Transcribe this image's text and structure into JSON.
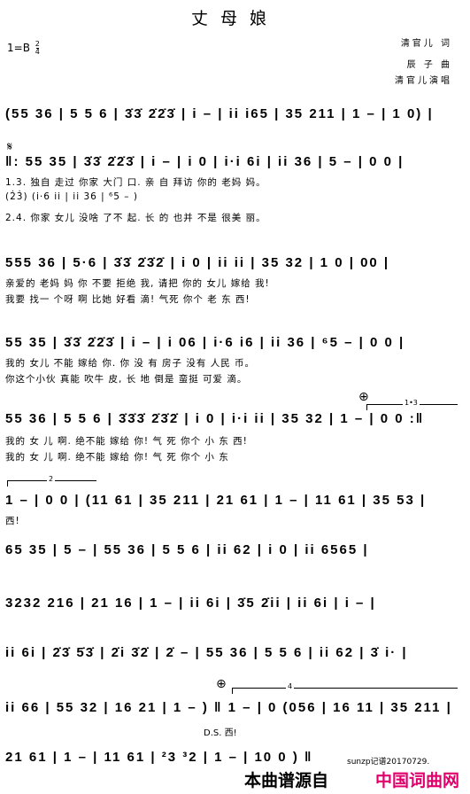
{
  "title": "丈母娘",
  "key_signature": "1=B",
  "time_signature": {
    "top": "2",
    "bottom": "4"
  },
  "credits": [
    "清官儿  词",
    "辰  子  曲",
    "清官儿演唱"
  ],
  "colors": {
    "text": "#000000",
    "brand": "#e0006c"
  },
  "score": [
    {
      "id": "line-1",
      "notes": "(55 36 | 5 5 6 | 3̇3̇ 2̇2̇3̇ | i – | ii i65 | 35 211 | 1 – | 1 0) |"
    },
    {
      "id": "line-2",
      "prefix": "𝄋",
      "notes": "‖: 55 35 | 3̇3̇ 2̇2̇3̇ | i – | i 0 | i·i 6i | ii 36 | 5 – | 0 0 |",
      "lyrics": [
        "1.3. 独自 走过  你家 大门    口.              亲  自 拜访  你的 老妈   妈。",
        "                   (2̇3̇)                   (i·6 ii | ii 36 | ⁶5 – )",
        "2.4. 你家 女儿  没啥 了不     起.              长  的 也并  不是 很美   丽。"
      ]
    },
    {
      "id": "line-3",
      "notes": "555 36 | 5·6 | 3̇3̇ 2̇3̇2̇ | i 0 | ii ii | 35 32 | 1 0 | 00 |",
      "lyrics": [
        "亲爱的 老妈  妈  你   不要 拒绝     我,      请把 你的  女儿 嫁给    我!",
        "我要   找一  个呀 啊   比她 好看     滴!      气死 你个  老   东      西!"
      ]
    },
    {
      "id": "line-4",
      "notes": "55 35 | 3̇3̇ 2̇2̇3̇ | i – | i 06 | i·6 i6 | ii 36 | ⁶5 – | 0 0 |",
      "lyrics": [
        "我的  女儿  不能 嫁给   你.          你  没  有 房子  没有 人民    币。",
        "你这个小伙  真能 吹牛   皮,              长  地 倒是  蛮挺 可爱    滴。"
      ]
    },
    {
      "id": "line-5",
      "notes": "55 36 | 5 5 6 | 3̇3̇3̇ 2̇3̇2̇ | i 0 | i·i ii | 35 32 | 1 – | 0 0 :‖",
      "ending": "1•3",
      "lyrics": [
        "我的 女    儿 啊.   绝不能 嫁给    你!    气  死 你个  小   东     西!",
        "我的 女    儿 啊.   绝不能 嫁给    你!    气  死 你个  小   东"
      ]
    },
    {
      "id": "line-6",
      "ending": "2",
      "notes": "1 – | 0 0 | (11 61 | 35 211 | 21 61 | 1 – | 11 61 | 35 53 |",
      "lyrics": [
        "西!"
      ]
    },
    {
      "id": "line-7",
      "notes": "65 35 | 5 – | 55 36 | 5 5 6 | ii 62 | i 0 | ii 6565 |"
    },
    {
      "id": "line-8",
      "notes": "3232 216 | 21 16 | 1 – | ii 6i | 3̇5 2̇ii | ii 6i | i – |"
    },
    {
      "id": "line-9",
      "notes": "ii 6i | 2̇3̇ 5̇3̇ | 2̇i 3̇2̇ | 2̇ – | 55 36 | 5 5 6 | ii 62 | 3̇ i· |"
    },
    {
      "id": "line-10",
      "notes": "ii 66 | 55 32 | 16 21 | 1 – ) ‖ 1 – | 0 (056 | 16 11 | 35 211 |",
      "ending": "4",
      "coda": "⊕",
      "lyrics": [
        "D.S. 西!"
      ]
    },
    {
      "id": "line-11",
      "notes": "21 61 | 1 – | 11 61 | ²3 ³2 | 1 – | 10 0 ) ‖"
    }
  ],
  "signature": "sunzp记谱20170729.",
  "footer": {
    "prefix": "本曲谱源自",
    "brand": "中国词曲网"
  }
}
